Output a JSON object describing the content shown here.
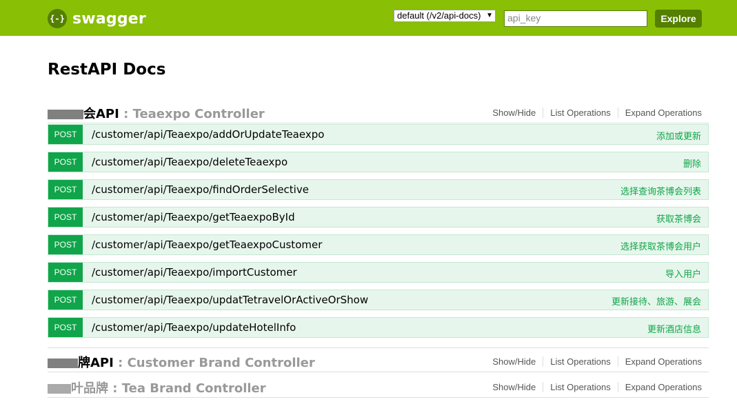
{
  "header": {
    "logo_glyph": "{-}",
    "logo_text": "swagger",
    "spec_select": "default (/v2/api-docs)",
    "api_key_placeholder": "api_key",
    "explore_label": "Explore",
    "colors": {
      "bar": "#89bf04",
      "button": "#547f00"
    }
  },
  "page_title": "RestAPI Docs",
  "resources": [
    {
      "name_cn": "会API",
      "name_sep": " : ",
      "name_en": "Teaexpo Controller",
      "links": [
        "Show/Hide",
        "List Operations",
        "Expand Operations"
      ],
      "operations": [
        {
          "method": "POST",
          "path": "/customer/api/Teaexpo/addOrUpdateTeaexpo",
          "summary": "添加或更新"
        },
        {
          "method": "POST",
          "path": "/customer/api/Teaexpo/deleteTeaexpo",
          "summary": "删除"
        },
        {
          "method": "POST",
          "path": "/customer/api/Teaexpo/findOrderSelective",
          "summary": "选择查询茶博会列表"
        },
        {
          "method": "POST",
          "path": "/customer/api/Teaexpo/getTeaexpoById",
          "summary": "获取茶博会"
        },
        {
          "method": "POST",
          "path": "/customer/api/Teaexpo/getTeaexpoCustomer",
          "summary": "选择获取茶博会用户"
        },
        {
          "method": "POST",
          "path": "/customer/api/Teaexpo/importCustomer",
          "summary": "导入用户"
        },
        {
          "method": "POST",
          "path": "/customer/api/Teaexpo/updatTetravelOrActiveOrShow",
          "summary": "更新接待、旅游、展会"
        },
        {
          "method": "POST",
          "path": "/customer/api/Teaexpo/updateHotelInfo",
          "summary": "更新酒店信息"
        }
      ]
    },
    {
      "name_cn": "牌API",
      "name_sep": " : ",
      "name_en": "Customer Brand Controller",
      "links": [
        "Show/Hide",
        "List Operations",
        "Expand Operations"
      ]
    },
    {
      "name_cn": "叶品牌",
      "name_sep": " : ",
      "name_en": "Tea Brand Controller",
      "links": [
        "Show/Hide",
        "List Operations",
        "Expand Operations"
      ]
    }
  ]
}
